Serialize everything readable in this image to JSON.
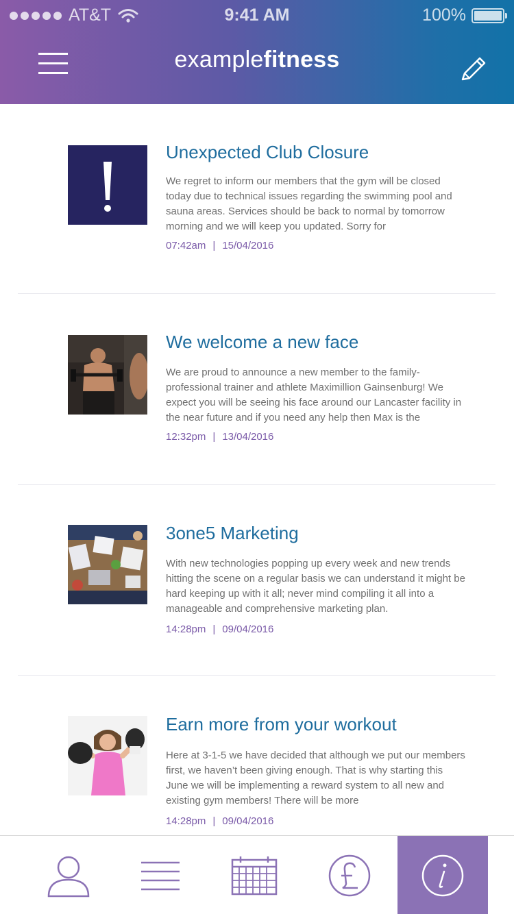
{
  "status_bar": {
    "carrier": "AT&T",
    "time": "9:41 AM",
    "battery": "100%"
  },
  "header": {
    "brand_light": "example",
    "brand_bold": "fitness",
    "menu_icon": "hamburger-icon",
    "edit_icon": "pencil-icon"
  },
  "feed": {
    "items": [
      {
        "title": "Unexpected Club Closure",
        "body": "We regret to inform our members that the gym will be closed today due to technical issues regarding the swimming pool and sauna areas. Services should be back to normal by tomorrow morning and we will keep you updated. Sorry for",
        "time": "07:42am",
        "date": "15/04/2016",
        "thumb": "alert-icon"
      },
      {
        "title": "We welcome a new face",
        "body": "We are proud to announce a new member to the family- professional trainer and athlete Maximillion Gainsenburg! We expect you will be seeing his face around our Lancaster facility in the near future and if you need any help then Max is the",
        "time": "12:32pm",
        "date": "13/04/2016",
        "thumb": "trainer-photo"
      },
      {
        "title": "3one5 Marketing",
        "body": "With new technologies popping up every week and new trends hitting the scene on a regular basis we can understand it might be hard keeping up with it all; never mind compiling it all into a manageable and comprehensive marketing plan.",
        "time": "14:28pm",
        "date": "09/04/2016",
        "thumb": "meeting-photo"
      },
      {
        "title": "Earn more from your workout",
        "body": "Here at 3-1-5 we have decided that although we put our members first, we haven’t been giving enough. That is why starting this June we will be implementing a reward system to all new and existing gym members! There will be more",
        "time": "14:28pm",
        "date": "09/04/2016",
        "thumb": "boxer-photo"
      }
    ],
    "separator": "|"
  },
  "tabbar": {
    "tabs": [
      {
        "icon": "profile-icon",
        "active": false
      },
      {
        "icon": "list-icon",
        "active": false
      },
      {
        "icon": "calendar-icon",
        "active": false
      },
      {
        "icon": "pound-icon",
        "active": false
      },
      {
        "icon": "info-icon",
        "active": true
      }
    ]
  },
  "colors": {
    "accent": "#8b72b5",
    "title": "#1f6d9e",
    "meta": "#7a5aa8",
    "alert_bg": "#262460"
  }
}
